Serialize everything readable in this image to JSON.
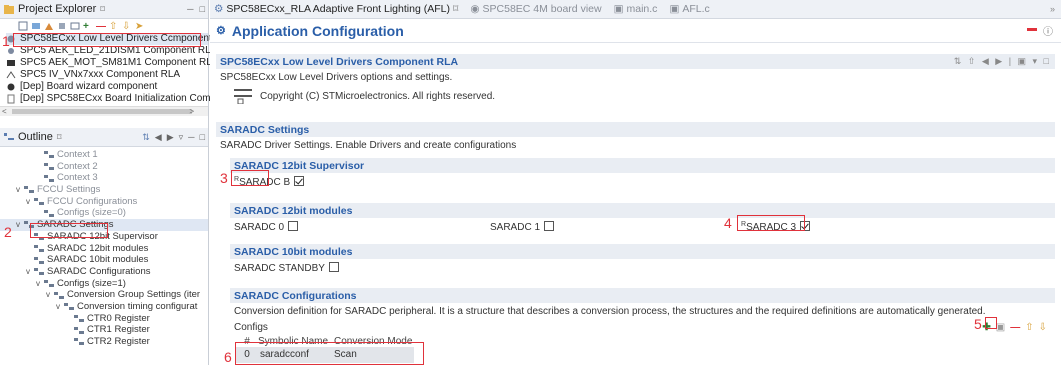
{
  "left_top": {
    "title": "Project Explorer",
    "title_suffix": "⌑",
    "items": [
      {
        "label": "SPC58ECxx Low Level Drivers Ccmponent RL",
        "icon": "component-icon"
      },
      {
        "label": "SPC5 AEK_LED_21DISM1 Component RLA",
        "icon": "component-icon"
      },
      {
        "label": "SPC5 AEK_MOT_SM81M1 Component RLA",
        "icon": "component-icon"
      },
      {
        "label": "SPC5 IV_VNx7xxx Component RLA",
        "icon": "component-icon"
      },
      {
        "label": "[Dep] Board wizard component",
        "icon": "dep-icon"
      },
      {
        "label": "[Dep] SPC58ECxx Board Initialization Compc",
        "icon": "dep-icon"
      }
    ]
  },
  "outline": {
    "title": "Outline",
    "title_suffix": "⌑",
    "items": [
      {
        "label": "Context 1",
        "indent": 3,
        "grey": true,
        "chev": ""
      },
      {
        "label": "Context 2",
        "indent": 3,
        "grey": true,
        "chev": ""
      },
      {
        "label": "Context 3",
        "indent": 3,
        "grey": true,
        "chev": ""
      },
      {
        "label": "FCCU Settings",
        "indent": 1,
        "grey": true,
        "chev": "v"
      },
      {
        "label": "FCCU Configurations",
        "indent": 2,
        "grey": true,
        "chev": "v"
      },
      {
        "label": "Configs (size=0)",
        "indent": 3,
        "grey": true,
        "chev": ""
      },
      {
        "label": "SARADC Settings",
        "indent": 1,
        "grey": false,
        "chev": "v"
      },
      {
        "label": "SARADC 12bit Supervisor",
        "indent": 2,
        "grey": false,
        "chev": ""
      },
      {
        "label": "SARADC 12bit modules",
        "indent": 2,
        "grey": false,
        "chev": ""
      },
      {
        "label": "SARADC 10bit modules",
        "indent": 2,
        "grey": false,
        "chev": ""
      },
      {
        "label": "SARADC Configurations",
        "indent": 2,
        "grey": false,
        "chev": "v"
      },
      {
        "label": "Configs (size=1)",
        "indent": 3,
        "grey": false,
        "chev": "v"
      },
      {
        "label": "Conversion Group Settings (iter",
        "indent": 4,
        "grey": false,
        "chev": "v"
      },
      {
        "label": "Conversion timing configurat",
        "indent": 5,
        "grey": false,
        "chev": "v"
      },
      {
        "label": "CTR0 Register",
        "indent": 6,
        "grey": false,
        "chev": ""
      },
      {
        "label": "CTR1 Register",
        "indent": 6,
        "grey": false,
        "chev": ""
      },
      {
        "label": "CTR2 Register",
        "indent": 6,
        "grey": false,
        "chev": ""
      }
    ]
  },
  "tabs": [
    {
      "label": "SPC58ECxx_RLA Adaptive Front Lighting (AFL)",
      "suffix": "⌑",
      "active": true
    },
    {
      "label": "SPC58EC 4M board view",
      "active": false
    },
    {
      "label": "main.c",
      "active": false
    },
    {
      "label": "AFL.c",
      "active": false
    }
  ],
  "header": {
    "title": "Application Configuration"
  },
  "component": {
    "title": "SPC58ECxx Low Level Drivers Component RLA",
    "desc": "SPC58ECxx Low Level Drivers options and settings.",
    "copyright": "Copyright (C) STMicroelectronics. All rights reserved."
  },
  "saradc_settings": {
    "title": "SARADC Settings",
    "desc": "SARADC Driver Settings. Enable Drivers and create configurations"
  },
  "supervisor": {
    "title": "SARADC 12bit Supervisor",
    "item": "SARADC B",
    "sup": "R",
    "checked": true
  },
  "modules12": {
    "title": "SARADC 12bit modules",
    "items": [
      {
        "label": "SARADC 0",
        "checked": false,
        "sup": ""
      },
      {
        "label": "SARADC 1",
        "checked": false,
        "sup": ""
      },
      {
        "label": "SARADC 3",
        "checked": true,
        "sup": "R"
      }
    ]
  },
  "modules10": {
    "title": "SARADC 10bit modules",
    "item": "SARADC STANDBY",
    "checked": false
  },
  "configurations": {
    "title": "SARADC Configurations",
    "desc": "Conversion definition for SARADC peripheral. It is a structure that describes a conversion process, the structures and the required definitions are automatically generated.",
    "configs_label": "Configs",
    "table_headers": [
      "#",
      "Symbolic Name",
      "Conversion Mode"
    ],
    "rows": [
      [
        "0",
        "saradcconf",
        "Scan"
      ]
    ]
  },
  "annotations": [
    "1",
    "2",
    "3",
    "4",
    "5",
    "6"
  ],
  "colors": {
    "accent": "#2a5ea8",
    "annotation": "#e0323b",
    "section_bg": "#e9edf3"
  }
}
